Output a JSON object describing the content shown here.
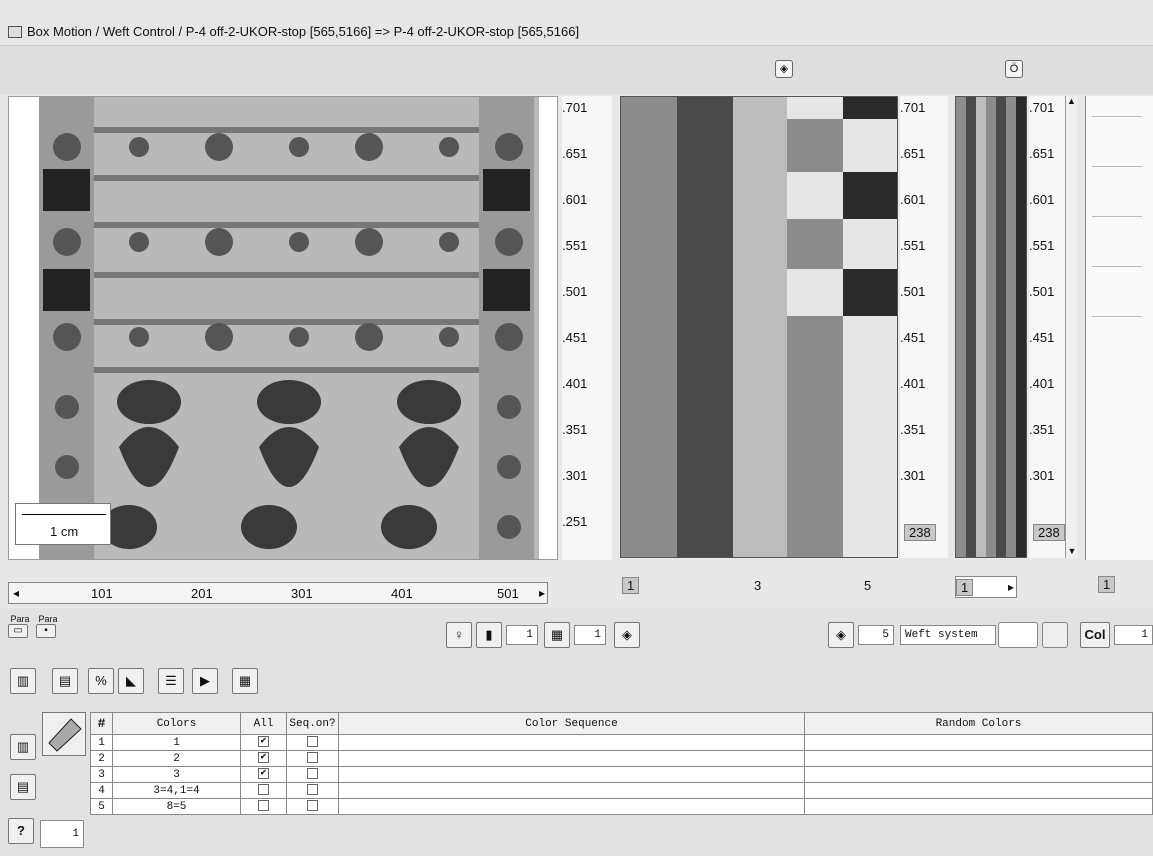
{
  "window": {
    "title": "Box Motion / Weft Control  / P-4 off-2-UKOR-stop [565,5166] => P-4 off-2-UKOR-stop [565,5166]"
  },
  "design": {
    "scale_label": "1 cm",
    "v_ticks": [
      ".701",
      ".651",
      ".601",
      ".551",
      ".501",
      ".451",
      ".401",
      ".351",
      ".301",
      ".251"
    ],
    "h_ticks": [
      "101",
      "201",
      "301",
      "401",
      "501"
    ]
  },
  "pattern": {
    "v_ticks": [
      ".701",
      ".651",
      ".601",
      ".551",
      ".501",
      ".451",
      ".401",
      ".351",
      ".301"
    ],
    "counter": "238",
    "h_ticks": [
      "1",
      "3",
      "5"
    ]
  },
  "narrow": {
    "v_ticks": [
      ".701",
      ".651",
      ".601",
      ".551",
      ".501",
      ".451",
      ".401",
      ".351",
      ".301"
    ],
    "counter": "238",
    "h_tick": "1"
  },
  "farright": {
    "h_tick": "1"
  },
  "toolbar": {
    "para_open": "Para",
    "para_save": "Para",
    "count1": "1",
    "count2": "1",
    "weft_count": "5",
    "weft_system": "Weft system",
    "col_label": "Col",
    "col_value": "1"
  },
  "side": {
    "help": "?",
    "value": "1"
  },
  "table": {
    "headers": {
      "num": "#",
      "colors": "Colors",
      "all": "All",
      "seq": "Seq.on?",
      "sequence": "Color Sequence",
      "random": "Random Colors"
    },
    "rows": [
      {
        "n": "1",
        "colors": "1",
        "all": "✔",
        "seq": ""
      },
      {
        "n": "2",
        "colors": "2",
        "all": "✔",
        "seq": ""
      },
      {
        "n": "3",
        "colors": "3",
        "all": "✔",
        "seq": ""
      },
      {
        "n": "4",
        "colors": "3=4,1=4",
        "all": "",
        "seq": ""
      },
      {
        "n": "5",
        "colors": "8=5",
        "all": "",
        "seq": ""
      }
    ]
  },
  "colors": {
    "stripe_dark": "#4a4a4a",
    "stripe_mid": "#8c8c8c",
    "stripe_light": "#bdbdbd",
    "stripe_pale": "#e6e6e6",
    "stripe_black": "#2a2a2a"
  }
}
